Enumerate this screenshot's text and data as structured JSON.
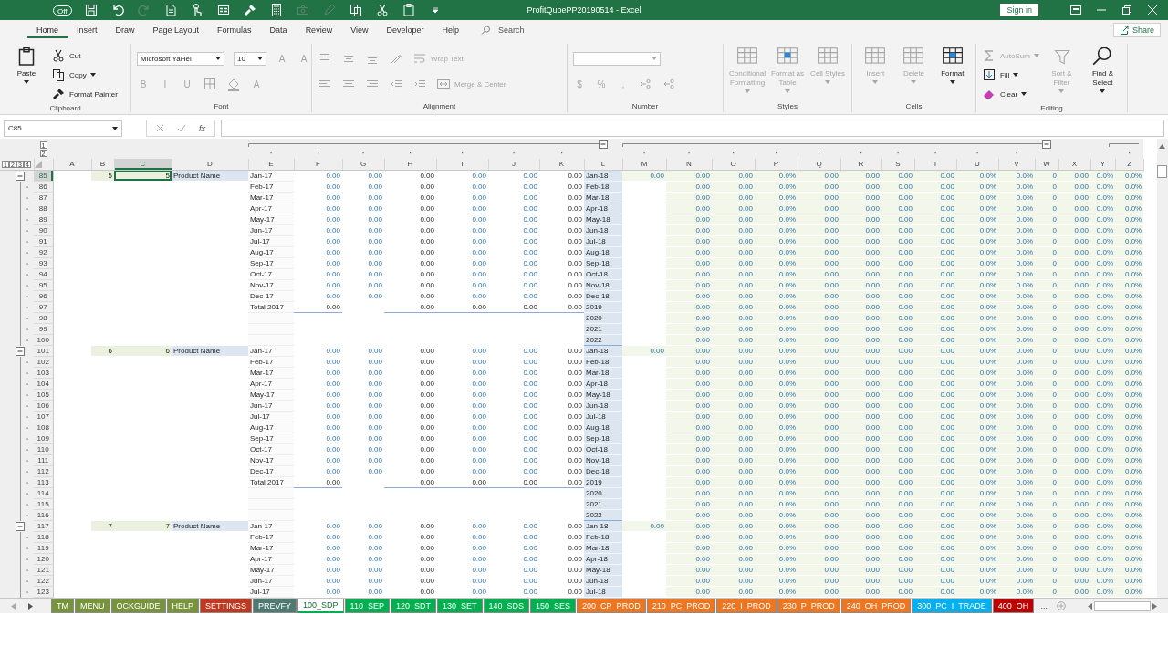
{
  "title_bar": {
    "autosave": {
      "label": "Off",
      "on": false
    },
    "quick_access": [
      {
        "disabled": false
      },
      {
        "disabled": false
      },
      {
        "disabled": true
      },
      {
        "disabled": false
      },
      {
        "disabled": false
      },
      {
        "disabled": false
      },
      {
        "disabled": false
      },
      {
        "disabled": false
      },
      {
        "disabled": true
      },
      {
        "disabled": true
      },
      {
        "disabled": false
      },
      {
        "disabled": false
      },
      {
        "disabled": false
      },
      {
        "disabled": false
      }
    ],
    "title": "ProfitQubePP20190514  -  Excel",
    "sign_in": "Sign in"
  },
  "ribbon": {
    "tabs": [
      {
        "label": "Home",
        "selected": true
      },
      {
        "label": "Insert",
        "selected": false
      },
      {
        "label": "Draw",
        "selected": false
      },
      {
        "label": "Page Layout",
        "selected": false
      },
      {
        "label": "Formulas",
        "selected": false
      },
      {
        "label": "Data",
        "selected": false
      },
      {
        "label": "Review",
        "selected": false
      },
      {
        "label": "View",
        "selected": false
      },
      {
        "label": "Developer",
        "selected": false
      },
      {
        "label": "Help",
        "selected": false
      }
    ],
    "search": {
      "placeholder": "Search"
    },
    "share": "Share",
    "groups": [
      {
        "label": "Clipboard",
        "items": [
          {
            "kind": "large",
            "label": "Paste",
            "disabled": false,
            "menu": true
          },
          {
            "kind": "small",
            "label": "Cut",
            "disabled": false,
            "menu": false
          },
          {
            "kind": "small",
            "label": "Copy",
            "disabled": false,
            "menu": true
          },
          {
            "kind": "small",
            "label": "Format Painter",
            "disabled": false,
            "menu": false
          }
        ]
      },
      {
        "label": "Font",
        "top_row": [
          {
            "kind": "field",
            "value": "Microsoft YaHei",
            "disabled": false
          },
          {
            "kind": "field",
            "value": "10",
            "disabled": false
          },
          {
            "kind": "text",
            "label": "A",
            "disabled": true
          },
          {
            "kind": "text",
            "label": "A",
            "disabled": true
          }
        ],
        "bottom_row": [
          {
            "kind": "text",
            "label": "B",
            "disabled": true
          },
          {
            "kind": "text",
            "label": "I",
            "disabled": true
          },
          {
            "kind": "text",
            "label": "U",
            "disabled": true
          },
          {
            "kind": "icon",
            "disabled": true
          },
          {
            "kind": "icon",
            "disabled": true
          },
          {
            "kind": "text",
            "label": "A",
            "disabled": true
          }
        ]
      },
      {
        "label": "Alignment",
        "top_row": [
          {
            "kind": "icon",
            "disabled": true
          },
          {
            "kind": "icon",
            "disabled": true
          },
          {
            "kind": "icon",
            "disabled": true
          },
          {
            "kind": "icon",
            "disabled": true
          },
          {
            "kind": "small",
            "label": "Wrap Text",
            "disabled": true
          }
        ],
        "bottom_row": [
          {
            "kind": "icon",
            "disabled": true
          },
          {
            "kind": "icon",
            "disabled": true
          },
          {
            "kind": "icon",
            "disabled": true
          },
          {
            "kind": "icon",
            "disabled": true
          },
          {
            "kind": "icon",
            "disabled": true
          },
          {
            "kind": "small",
            "label": "Merge & Center",
            "disabled": true
          }
        ]
      },
      {
        "label": "Number",
        "top_row": [
          {
            "kind": "field",
            "disabled": true
          }
        ],
        "bottom_row": [
          {
            "kind": "text",
            "label": "$",
            "disabled": true
          },
          {
            "kind": "text",
            "label": "%",
            "disabled": true
          },
          {
            "kind": "text",
            "label": ",",
            "disabled": true
          },
          {
            "kind": "icon",
            "disabled": true
          },
          {
            "kind": "icon",
            "disabled": true
          }
        ]
      },
      {
        "label": "Styles",
        "items": [
          {
            "kind": "large",
            "label": "Conditional Formatting",
            "disabled": true,
            "menu": true
          },
          {
            "kind": "large",
            "label": "Format as Table",
            "disabled": true,
            "menu": true
          },
          {
            "kind": "large",
            "label": "Cell Styles",
            "disabled": true,
            "menu": true
          }
        ]
      },
      {
        "label": "Cells",
        "items": [
          {
            "kind": "large",
            "label": "Insert",
            "disabled": true,
            "menu": true
          },
          {
            "kind": "large",
            "label": "Delete",
            "disabled": true,
            "menu": true
          },
          {
            "kind": "large",
            "label": "Format",
            "disabled": false,
            "menu": true
          }
        ]
      },
      {
        "label": "Editing",
        "items": [
          {
            "kind": "small",
            "label": "AutoSum",
            "disabled": true,
            "menu": true
          },
          {
            "kind": "small",
            "label": "Fill",
            "disabled": false,
            "menu": true
          },
          {
            "kind": "small",
            "label": "Clear",
            "disabled": false,
            "menu": true
          },
          {
            "kind": "large",
            "label": "Sort & Filter",
            "disabled": true,
            "menu": true
          },
          {
            "kind": "large",
            "label": "Find & Select",
            "disabled": false,
            "menu": true
          }
        ]
      }
    ]
  },
  "formula_bar": {
    "name_box": "C85",
    "fx": "fx"
  },
  "outline_levels": {
    "columns": [
      "1",
      "2"
    ],
    "rows": [
      "1",
      "2",
      "3",
      "4"
    ]
  },
  "columns": [
    {
      "label": "A",
      "selected": false
    },
    {
      "label": "B",
      "selected": false
    },
    {
      "label": "C",
      "selected": true
    },
    {
      "label": "D",
      "selected": false
    },
    {
      "label": "E",
      "selected": false
    },
    {
      "label": "F",
      "selected": false
    },
    {
      "label": "G",
      "selected": false
    },
    {
      "label": "H",
      "selected": false
    },
    {
      "label": "I",
      "selected": false
    },
    {
      "label": "J",
      "selected": false
    },
    {
      "label": "K",
      "selected": false
    },
    {
      "label": "L",
      "selected": false
    },
    {
      "label": "M",
      "selected": false
    },
    {
      "label": "N",
      "selected": false
    },
    {
      "label": "O",
      "selected": false
    },
    {
      "label": "P",
      "selected": false
    },
    {
      "label": "Q",
      "selected": false
    },
    {
      "label": "R",
      "selected": false
    },
    {
      "label": "S",
      "selected": false
    },
    {
      "label": "T",
      "selected": false
    },
    {
      "label": "U",
      "selected": false
    },
    {
      "label": "V",
      "selected": false
    },
    {
      "label": "W",
      "selected": false
    },
    {
      "label": "X",
      "selected": false
    },
    {
      "label": "Y",
      "selected": false
    },
    {
      "label": "Z",
      "selected": false
    }
  ],
  "rows": [
    {
      "number": "85",
      "selected": true,
      "group_start": true,
      "kind": "month",
      "cells": [
        null,
        "5",
        "5",
        "Product Name",
        "Jan-17",
        "0.00",
        "0.00",
        "0.00",
        "0.00",
        "0.00",
        "0.00",
        "Jan-18",
        "0.00",
        "0.00",
        "0.00",
        "0.0%",
        "0.00",
        "0.00",
        "0.00",
        "0.00",
        "0.0%",
        "0.0%",
        "0",
        "0.00",
        "0.0%",
        "0.0%"
      ]
    },
    {
      "number": "86",
      "selected": false,
      "group_start": false,
      "kind": "month",
      "cells": [
        null,
        null,
        null,
        null,
        "Feb-17",
        "0.00",
        "0.00",
        "0.00",
        "0.00",
        "0.00",
        "0.00",
        "Feb-18",
        null,
        "0.00",
        "0.00",
        "0.0%",
        "0.00",
        "0.00",
        "0.00",
        "0.00",
        "0.0%",
        "0.0%",
        "0",
        "0.00",
        "0.0%",
        "0.0%"
      ]
    },
    {
      "number": "87",
      "selected": false,
      "group_start": false,
      "kind": "month",
      "cells": [
        null,
        null,
        null,
        null,
        "Mar-17",
        "0.00",
        "0.00",
        "0.00",
        "0.00",
        "0.00",
        "0.00",
        "Mar-18",
        null,
        "0.00",
        "0.00",
        "0.0%",
        "0.00",
        "0.00",
        "0.00",
        "0.00",
        "0.0%",
        "0.0%",
        "0",
        "0.00",
        "0.0%",
        "0.0%"
      ]
    },
    {
      "number": "88",
      "selected": false,
      "group_start": false,
      "kind": "month",
      "cells": [
        null,
        null,
        null,
        null,
        "Apr-17",
        "0.00",
        "0.00",
        "0.00",
        "0.00",
        "0.00",
        "0.00",
        "Apr-18",
        null,
        "0.00",
        "0.00",
        "0.0%",
        "0.00",
        "0.00",
        "0.00",
        "0.00",
        "0.0%",
        "0.0%",
        "0",
        "0.00",
        "0.0%",
        "0.0%"
      ]
    },
    {
      "number": "89",
      "selected": false,
      "group_start": false,
      "kind": "month",
      "cells": [
        null,
        null,
        null,
        null,
        "May-17",
        "0.00",
        "0.00",
        "0.00",
        "0.00",
        "0.00",
        "0.00",
        "May-18",
        null,
        "0.00",
        "0.00",
        "0.0%",
        "0.00",
        "0.00",
        "0.00",
        "0.00",
        "0.0%",
        "0.0%",
        "0",
        "0.00",
        "0.0%",
        "0.0%"
      ]
    },
    {
      "number": "90",
      "selected": false,
      "group_start": false,
      "kind": "month",
      "cells": [
        null,
        null,
        null,
        null,
        "Jun-17",
        "0.00",
        "0.00",
        "0.00",
        "0.00",
        "0.00",
        "0.00",
        "Jun-18",
        null,
        "0.00",
        "0.00",
        "0.0%",
        "0.00",
        "0.00",
        "0.00",
        "0.00",
        "0.0%",
        "0.0%",
        "0",
        "0.00",
        "0.0%",
        "0.0%"
      ]
    },
    {
      "number": "91",
      "selected": false,
      "group_start": false,
      "kind": "month",
      "cells": [
        null,
        null,
        null,
        null,
        "Jul-17",
        "0.00",
        "0.00",
        "0.00",
        "0.00",
        "0.00",
        "0.00",
        "Jul-18",
        null,
        "0.00",
        "0.00",
        "0.0%",
        "0.00",
        "0.00",
        "0.00",
        "0.00",
        "0.0%",
        "0.0%",
        "0",
        "0.00",
        "0.0%",
        "0.0%"
      ]
    },
    {
      "number": "92",
      "selected": false,
      "group_start": false,
      "kind": "month",
      "cells": [
        null,
        null,
        null,
        null,
        "Aug-17",
        "0.00",
        "0.00",
        "0.00",
        "0.00",
        "0.00",
        "0.00",
        "Aug-18",
        null,
        "0.00",
        "0.00",
        "0.0%",
        "0.00",
        "0.00",
        "0.00",
        "0.00",
        "0.0%",
        "0.0%",
        "0",
        "0.00",
        "0.0%",
        "0.0%"
      ]
    },
    {
      "number": "93",
      "selected": false,
      "group_start": false,
      "kind": "month",
      "cells": [
        null,
        null,
        null,
        null,
        "Sep-17",
        "0.00",
        "0.00",
        "0.00",
        "0.00",
        "0.00",
        "0.00",
        "Sep-18",
        null,
        "0.00",
        "0.00",
        "0.0%",
        "0.00",
        "0.00",
        "0.00",
        "0.00",
        "0.0%",
        "0.0%",
        "0",
        "0.00",
        "0.0%",
        "0.0%"
      ]
    },
    {
      "number": "94",
      "selected": false,
      "group_start": false,
      "kind": "month",
      "cells": [
        null,
        null,
        null,
        null,
        "Oct-17",
        "0.00",
        "0.00",
        "0.00",
        "0.00",
        "0.00",
        "0.00",
        "Oct-18",
        null,
        "0.00",
        "0.00",
        "0.0%",
        "0.00",
        "0.00",
        "0.00",
        "0.00",
        "0.0%",
        "0.0%",
        "0",
        "0.00",
        "0.0%",
        "0.0%"
      ]
    },
    {
      "number": "95",
      "selected": false,
      "group_start": false,
      "kind": "month",
      "cells": [
        null,
        null,
        null,
        null,
        "Nov-17",
        "0.00",
        "0.00",
        "0.00",
        "0.00",
        "0.00",
        "0.00",
        "Nov-18",
        null,
        "0.00",
        "0.00",
        "0.0%",
        "0.00",
        "0.00",
        "0.00",
        "0.00",
        "0.0%",
        "0.0%",
        "0",
        "0.00",
        "0.0%",
        "0.0%"
      ]
    },
    {
      "number": "96",
      "selected": false,
      "group_start": false,
      "kind": "month",
      "cells": [
        null,
        null,
        null,
        null,
        "Dec-17",
        "0.00",
        "0.00",
        "0.00",
        "0.00",
        "0.00",
        "0.00",
        "Dec-18",
        null,
        "0.00",
        "0.00",
        "0.0%",
        "0.00",
        "0.00",
        "0.00",
        "0.00",
        "0.0%",
        "0.0%",
        "0",
        "0.00",
        "0.0%",
        "0.0%"
      ]
    },
    {
      "number": "97",
      "selected": false,
      "group_start": false,
      "kind": "total",
      "cells": [
        null,
        null,
        null,
        null,
        "Total 2017",
        "0.00",
        null,
        "0.00",
        "0.00",
        "0.00",
        "0.00",
        "2019",
        null,
        "0.00",
        "0.00",
        "0.0%",
        "0.00",
        "0.00",
        "0.00",
        "0.00",
        "0.0%",
        "0.0%",
        "0",
        "0.00",
        "0.0%",
        "0.0%"
      ]
    },
    {
      "number": "98",
      "selected": false,
      "group_start": false,
      "kind": "year",
      "cells": [
        null,
        null,
        null,
        null,
        null,
        null,
        null,
        null,
        null,
        null,
        null,
        "2020",
        null,
        "0.00",
        "0.00",
        "0.0%",
        "0.00",
        "0.00",
        "0.00",
        "0.00",
        "0.0%",
        "0.0%",
        "0",
        "0.00",
        "0.0%",
        "0.0%"
      ]
    },
    {
      "number": "99",
      "selected": false,
      "group_start": false,
      "kind": "year",
      "cells": [
        null,
        null,
        null,
        null,
        null,
        null,
        null,
        null,
        null,
        null,
        null,
        "2021",
        null,
        "0.00",
        "0.00",
        "0.0%",
        "0.00",
        "0.00",
        "0.00",
        "0.00",
        "0.0%",
        "0.0%",
        "0",
        "0.00",
        "0.0%",
        "0.0%"
      ]
    },
    {
      "number": "100",
      "selected": false,
      "group_start": false,
      "kind": "year",
      "cells": [
        null,
        null,
        null,
        null,
        null,
        null,
        null,
        null,
        null,
        null,
        null,
        "2022",
        null,
        "0.00",
        "0.00",
        "0.0%",
        "0.00",
        "0.00",
        "0.00",
        "0.00",
        "0.0%",
        "0.0%",
        "0",
        "0.00",
        "0.0%",
        "0.0%"
      ]
    },
    {
      "number": "101",
      "selected": false,
      "group_start": true,
      "kind": "month",
      "cells": [
        null,
        "6",
        "6",
        "Product Name",
        "Jan-17",
        "0.00",
        "0.00",
        "0.00",
        "0.00",
        "0.00",
        "0.00",
        "Jan-18",
        "0.00",
        "0.00",
        "0.00",
        "0.0%",
        "0.00",
        "0.00",
        "0.00",
        "0.00",
        "0.0%",
        "0.0%",
        "0",
        "0.00",
        "0.0%",
        "0.0%"
      ]
    },
    {
      "number": "102",
      "selected": false,
      "group_start": false,
      "kind": "month",
      "cells": [
        null,
        null,
        null,
        null,
        "Feb-17",
        "0.00",
        "0.00",
        "0.00",
        "0.00",
        "0.00",
        "0.00",
        "Feb-18",
        null,
        "0.00",
        "0.00",
        "0.0%",
        "0.00",
        "0.00",
        "0.00",
        "0.00",
        "0.0%",
        "0.0%",
        "0",
        "0.00",
        "0.0%",
        "0.0%"
      ]
    },
    {
      "number": "103",
      "selected": false,
      "group_start": false,
      "kind": "month",
      "cells": [
        null,
        null,
        null,
        null,
        "Mar-17",
        "0.00",
        "0.00",
        "0.00",
        "0.00",
        "0.00",
        "0.00",
        "Mar-18",
        null,
        "0.00",
        "0.00",
        "0.0%",
        "0.00",
        "0.00",
        "0.00",
        "0.00",
        "0.0%",
        "0.0%",
        "0",
        "0.00",
        "0.0%",
        "0.0%"
      ]
    },
    {
      "number": "104",
      "selected": false,
      "group_start": false,
      "kind": "month",
      "cells": [
        null,
        null,
        null,
        null,
        "Apr-17",
        "0.00",
        "0.00",
        "0.00",
        "0.00",
        "0.00",
        "0.00",
        "Apr-18",
        null,
        "0.00",
        "0.00",
        "0.0%",
        "0.00",
        "0.00",
        "0.00",
        "0.00",
        "0.0%",
        "0.0%",
        "0",
        "0.00",
        "0.0%",
        "0.0%"
      ]
    },
    {
      "number": "105",
      "selected": false,
      "group_start": false,
      "kind": "month",
      "cells": [
        null,
        null,
        null,
        null,
        "May-17",
        "0.00",
        "0.00",
        "0.00",
        "0.00",
        "0.00",
        "0.00",
        "May-18",
        null,
        "0.00",
        "0.00",
        "0.0%",
        "0.00",
        "0.00",
        "0.00",
        "0.00",
        "0.0%",
        "0.0%",
        "0",
        "0.00",
        "0.0%",
        "0.0%"
      ]
    },
    {
      "number": "106",
      "selected": false,
      "group_start": false,
      "kind": "month",
      "cells": [
        null,
        null,
        null,
        null,
        "Jun-17",
        "0.00",
        "0.00",
        "0.00",
        "0.00",
        "0.00",
        "0.00",
        "Jun-18",
        null,
        "0.00",
        "0.00",
        "0.0%",
        "0.00",
        "0.00",
        "0.00",
        "0.00",
        "0.0%",
        "0.0%",
        "0",
        "0.00",
        "0.0%",
        "0.0%"
      ]
    },
    {
      "number": "107",
      "selected": false,
      "group_start": false,
      "kind": "month",
      "cells": [
        null,
        null,
        null,
        null,
        "Jul-17",
        "0.00",
        "0.00",
        "0.00",
        "0.00",
        "0.00",
        "0.00",
        "Jul-18",
        null,
        "0.00",
        "0.00",
        "0.0%",
        "0.00",
        "0.00",
        "0.00",
        "0.00",
        "0.0%",
        "0.0%",
        "0",
        "0.00",
        "0.0%",
        "0.0%"
      ]
    },
    {
      "number": "108",
      "selected": false,
      "group_start": false,
      "kind": "month",
      "cells": [
        null,
        null,
        null,
        null,
        "Aug-17",
        "0.00",
        "0.00",
        "0.00",
        "0.00",
        "0.00",
        "0.00",
        "Aug-18",
        null,
        "0.00",
        "0.00",
        "0.0%",
        "0.00",
        "0.00",
        "0.00",
        "0.00",
        "0.0%",
        "0.0%",
        "0",
        "0.00",
        "0.0%",
        "0.0%"
      ]
    },
    {
      "number": "109",
      "selected": false,
      "group_start": false,
      "kind": "month",
      "cells": [
        null,
        null,
        null,
        null,
        "Sep-17",
        "0.00",
        "0.00",
        "0.00",
        "0.00",
        "0.00",
        "0.00",
        "Sep-18",
        null,
        "0.00",
        "0.00",
        "0.0%",
        "0.00",
        "0.00",
        "0.00",
        "0.00",
        "0.0%",
        "0.0%",
        "0",
        "0.00",
        "0.0%",
        "0.0%"
      ]
    },
    {
      "number": "110",
      "selected": false,
      "group_start": false,
      "kind": "month",
      "cells": [
        null,
        null,
        null,
        null,
        "Oct-17",
        "0.00",
        "0.00",
        "0.00",
        "0.00",
        "0.00",
        "0.00",
        "Oct-18",
        null,
        "0.00",
        "0.00",
        "0.0%",
        "0.00",
        "0.00",
        "0.00",
        "0.00",
        "0.0%",
        "0.0%",
        "0",
        "0.00",
        "0.0%",
        "0.0%"
      ]
    },
    {
      "number": "111",
      "selected": false,
      "group_start": false,
      "kind": "month",
      "cells": [
        null,
        null,
        null,
        null,
        "Nov-17",
        "0.00",
        "0.00",
        "0.00",
        "0.00",
        "0.00",
        "0.00",
        "Nov-18",
        null,
        "0.00",
        "0.00",
        "0.0%",
        "0.00",
        "0.00",
        "0.00",
        "0.00",
        "0.0%",
        "0.0%",
        "0",
        "0.00",
        "0.0%",
        "0.0%"
      ]
    },
    {
      "number": "112",
      "selected": false,
      "group_start": false,
      "kind": "month",
      "cells": [
        null,
        null,
        null,
        null,
        "Dec-17",
        "0.00",
        "0.00",
        "0.00",
        "0.00",
        "0.00",
        "0.00",
        "Dec-18",
        null,
        "0.00",
        "0.00",
        "0.0%",
        "0.00",
        "0.00",
        "0.00",
        "0.00",
        "0.0%",
        "0.0%",
        "0",
        "0.00",
        "0.0%",
        "0.0%"
      ]
    },
    {
      "number": "113",
      "selected": false,
      "group_start": false,
      "kind": "total",
      "cells": [
        null,
        null,
        null,
        null,
        "Total 2017",
        "0.00",
        null,
        "0.00",
        "0.00",
        "0.00",
        "0.00",
        "2019",
        null,
        "0.00",
        "0.00",
        "0.0%",
        "0.00",
        "0.00",
        "0.00",
        "0.00",
        "0.0%",
        "0.0%",
        "0",
        "0.00",
        "0.0%",
        "0.0%"
      ]
    },
    {
      "number": "114",
      "selected": false,
      "group_start": false,
      "kind": "year",
      "cells": [
        null,
        null,
        null,
        null,
        null,
        null,
        null,
        null,
        null,
        null,
        null,
        "2020",
        null,
        "0.00",
        "0.00",
        "0.0%",
        "0.00",
        "0.00",
        "0.00",
        "0.00",
        "0.0%",
        "0.0%",
        "0",
        "0.00",
        "0.0%",
        "0.0%"
      ]
    },
    {
      "number": "115",
      "selected": false,
      "group_start": false,
      "kind": "year",
      "cells": [
        null,
        null,
        null,
        null,
        null,
        null,
        null,
        null,
        null,
        null,
        null,
        "2021",
        null,
        "0.00",
        "0.00",
        "0.0%",
        "0.00",
        "0.00",
        "0.00",
        "0.00",
        "0.0%",
        "0.0%",
        "0",
        "0.00",
        "0.0%",
        "0.0%"
      ]
    },
    {
      "number": "116",
      "selected": false,
      "group_start": false,
      "kind": "year",
      "cells": [
        null,
        null,
        null,
        null,
        null,
        null,
        null,
        null,
        null,
        null,
        null,
        "2022",
        null,
        "0.00",
        "0.00",
        "0.0%",
        "0.00",
        "0.00",
        "0.00",
        "0.00",
        "0.0%",
        "0.0%",
        "0",
        "0.00",
        "0.0%",
        "0.0%"
      ]
    },
    {
      "number": "117",
      "selected": false,
      "group_start": true,
      "kind": "month",
      "cells": [
        null,
        "7",
        "7",
        "Product Name",
        "Jan-17",
        "0.00",
        "0.00",
        "0.00",
        "0.00",
        "0.00",
        "0.00",
        "Jan-18",
        "0.00",
        "0.00",
        "0.00",
        "0.0%",
        "0.00",
        "0.00",
        "0.00",
        "0.00",
        "0.0%",
        "0.0%",
        "0",
        "0.00",
        "0.0%",
        "0.0%"
      ]
    },
    {
      "number": "118",
      "selected": false,
      "group_start": false,
      "kind": "month",
      "cells": [
        null,
        null,
        null,
        null,
        "Feb-17",
        "0.00",
        "0.00",
        "0.00",
        "0.00",
        "0.00",
        "0.00",
        "Feb-18",
        null,
        "0.00",
        "0.00",
        "0.0%",
        "0.00",
        "0.00",
        "0.00",
        "0.00",
        "0.0%",
        "0.0%",
        "0",
        "0.00",
        "0.0%",
        "0.0%"
      ]
    },
    {
      "number": "119",
      "selected": false,
      "group_start": false,
      "kind": "month",
      "cells": [
        null,
        null,
        null,
        null,
        "Mar-17",
        "0.00",
        "0.00",
        "0.00",
        "0.00",
        "0.00",
        "0.00",
        "Mar-18",
        null,
        "0.00",
        "0.00",
        "0.0%",
        "0.00",
        "0.00",
        "0.00",
        "0.00",
        "0.0%",
        "0.0%",
        "0",
        "0.00",
        "0.0%",
        "0.0%"
      ]
    },
    {
      "number": "120",
      "selected": false,
      "group_start": false,
      "kind": "month",
      "cells": [
        null,
        null,
        null,
        null,
        "Apr-17",
        "0.00",
        "0.00",
        "0.00",
        "0.00",
        "0.00",
        "0.00",
        "Apr-18",
        null,
        "0.00",
        "0.00",
        "0.0%",
        "0.00",
        "0.00",
        "0.00",
        "0.00",
        "0.0%",
        "0.0%",
        "0",
        "0.00",
        "0.0%",
        "0.0%"
      ]
    },
    {
      "number": "121",
      "selected": false,
      "group_start": false,
      "kind": "month",
      "cells": [
        null,
        null,
        null,
        null,
        "May-17",
        "0.00",
        "0.00",
        "0.00",
        "0.00",
        "0.00",
        "0.00",
        "May-18",
        null,
        "0.00",
        "0.00",
        "0.0%",
        "0.00",
        "0.00",
        "0.00",
        "0.00",
        "0.0%",
        "0.0%",
        "0",
        "0.00",
        "0.0%",
        "0.0%"
      ]
    },
    {
      "number": "122",
      "selected": false,
      "group_start": false,
      "kind": "month",
      "cells": [
        null,
        null,
        null,
        null,
        "Jun-17",
        "0.00",
        "0.00",
        "0.00",
        "0.00",
        "0.00",
        "0.00",
        "Jun-18",
        null,
        "0.00",
        "0.00",
        "0.0%",
        "0.00",
        "0.00",
        "0.00",
        "0.00",
        "0.0%",
        "0.0%",
        "0",
        "0.00",
        "0.0%",
        "0.0%"
      ]
    },
    {
      "number": "123",
      "selected": false,
      "group_start": false,
      "kind": "month",
      "cells": [
        null,
        null,
        null,
        null,
        "Jul-17",
        "0.00",
        "0.00",
        "0.00",
        "0.00",
        "0.00",
        "0.00",
        "Jul-18",
        null,
        "0.00",
        "0.00",
        "0.0%",
        "0.00",
        "0.00",
        "0.00",
        "0.00",
        "0.0%",
        "0.0%",
        "0",
        "0.00",
        "0.0%",
        "0.0%"
      ]
    }
  ],
  "sheet_tabs": [
    {
      "label": "TM",
      "color": "#77933c",
      "selected": false
    },
    {
      "label": "MENU",
      "color": "#77933c",
      "selected": false
    },
    {
      "label": "QCKGUIDE",
      "color": "#77933c",
      "selected": false
    },
    {
      "label": "HELP",
      "color": "#77933c",
      "selected": false
    },
    {
      "label": "SETTINGS",
      "color": "#c0381f",
      "selected": false
    },
    {
      "label": "PREVFY",
      "color": "#4e7a72",
      "selected": false
    },
    {
      "label": "100_SDP",
      "color": "#00b050",
      "selected": true
    },
    {
      "label": "110_SEP",
      "color": "#00b050",
      "selected": false
    },
    {
      "label": "120_SDT",
      "color": "#00b050",
      "selected": false
    },
    {
      "label": "130_SET",
      "color": "#00b050",
      "selected": false
    },
    {
      "label": "140_SDS",
      "color": "#00b050",
      "selected": false
    },
    {
      "label": "150_SES",
      "color": "#00b050",
      "selected": false
    },
    {
      "label": "200_CP_PROD",
      "color": "#ee7621",
      "selected": false
    },
    {
      "label": "210_PC_PROD",
      "color": "#ee7621",
      "selected": false
    },
    {
      "label": "220_I_PROD",
      "color": "#ee7621",
      "selected": false
    },
    {
      "label": "230_P_PROD",
      "color": "#ee7621",
      "selected": false
    },
    {
      "label": "240_OH_PROD",
      "color": "#ee7621",
      "selected": false
    },
    {
      "label": "300_PC_I_TRADE",
      "color": "#00b0f0",
      "selected": false
    },
    {
      "label": "400_OH",
      "color": "#c00000",
      "selected": false
    }
  ],
  "more_tabs": "..."
}
